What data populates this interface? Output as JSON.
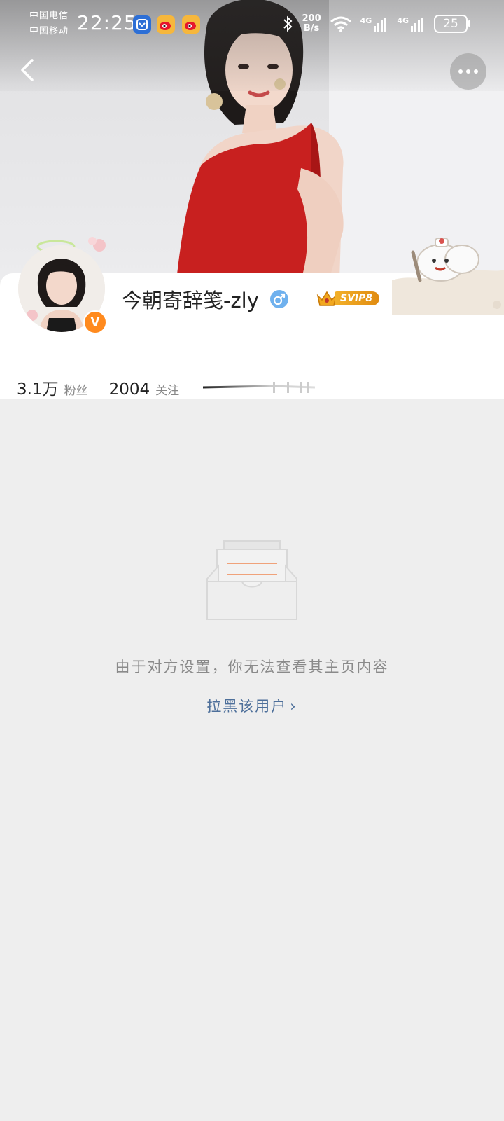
{
  "status_bar": {
    "carrier_1": "中国电信",
    "carrier_2": "中国移动",
    "time": "22:25",
    "net_speed_value": "200",
    "net_speed_unit": "B/s",
    "signal_1_label": "4G",
    "signal_2_label": "4G",
    "battery": "25",
    "app_icons": [
      "blue-app-icon",
      "weibo-icon",
      "weibo-icon"
    ]
  },
  "header": {
    "back_icon": "chevron-left-icon",
    "more_icon": "more-dots-icon"
  },
  "profile": {
    "username": "今朝寄辞笺-zly",
    "gender": "male",
    "verified_badge": "V",
    "vip_label": "SVIP8",
    "followers_count": "3.1万",
    "followers_label": "粉丝",
    "following_count": "2004",
    "following_label": "关注"
  },
  "empty_state": {
    "icon": "empty-inbox-icon",
    "message": "由于对方设置，你无法查看其主页内容",
    "action_label": "拉黑该用户",
    "action_chevron": "›"
  },
  "colors": {
    "accent_link": "#4d6f9a",
    "verified_badge": "#ff8a1e",
    "vip_gold": "#f3b12a",
    "gender_blue": "#6fb1ee",
    "page_background": "#eeeeee"
  }
}
